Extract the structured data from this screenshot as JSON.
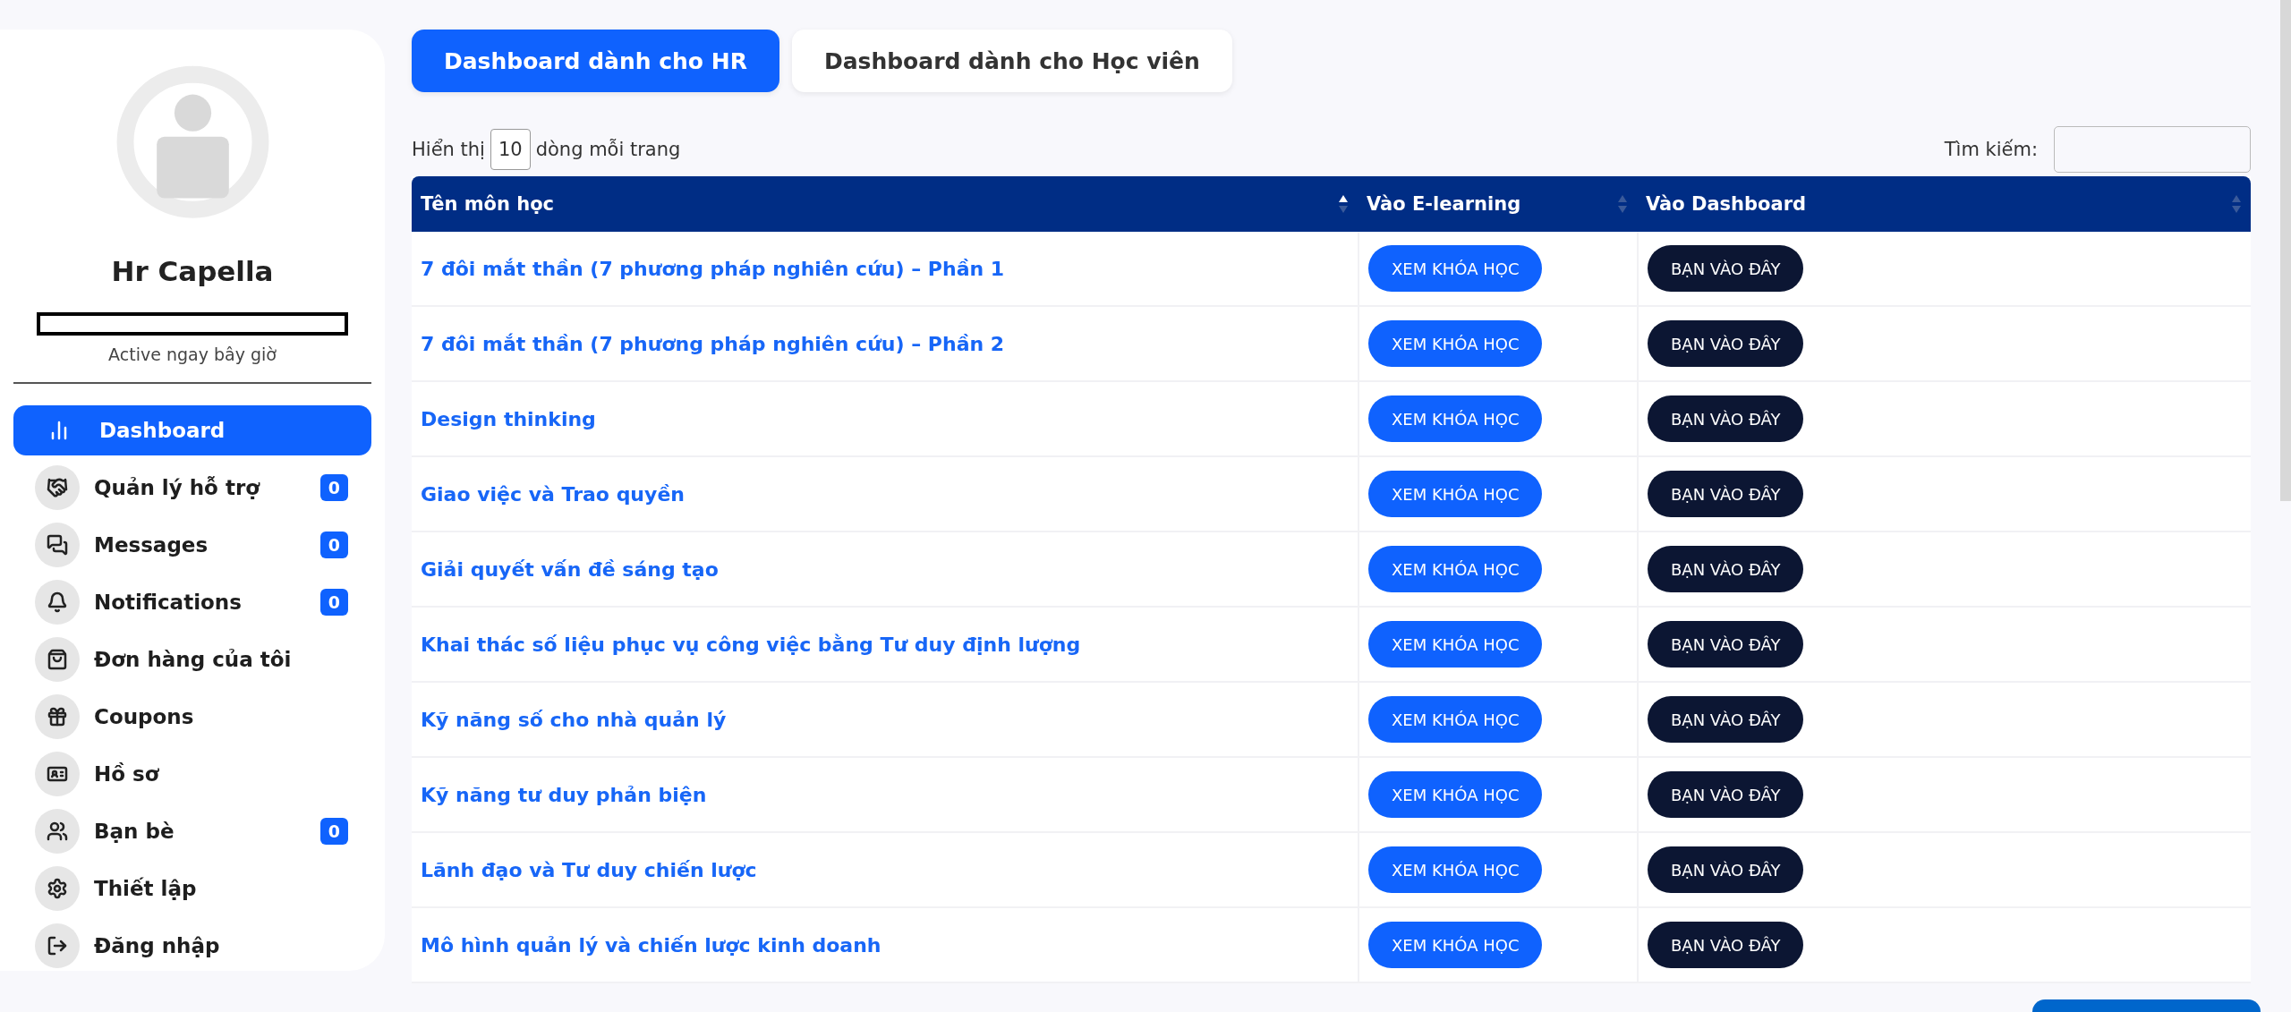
{
  "profile": {
    "name": "Hr Capella",
    "status": "Active ngay bây giờ"
  },
  "menu": [
    {
      "label": "Dashboard",
      "selected": true
    },
    {
      "label": "Quản lý hỗ trợ",
      "selected": false,
      "badge": "0"
    },
    {
      "label": "Messages",
      "selected": false,
      "badge": "0"
    },
    {
      "label": "Notifications",
      "selected": false,
      "badge": "0"
    },
    {
      "label": "Đơn hàng của tôi",
      "selected": false
    },
    {
      "label": "Coupons",
      "selected": false
    },
    {
      "label": "Hồ sơ",
      "selected": false
    },
    {
      "label": "Bạn bè",
      "selected": false,
      "badge": "0"
    },
    {
      "label": "Thiết lập",
      "selected": false
    },
    {
      "label": "Đăng nhập",
      "selected": false
    }
  ],
  "tabs": [
    {
      "label": "Dashboard dành cho HR",
      "selected": true
    },
    {
      "label": "Dashboard dành cho Học viên",
      "selected": false
    }
  ],
  "length_control": {
    "before": "Hiển thị",
    "value": "10",
    "after": "dòng mỗi trang"
  },
  "search": {
    "label": "Tìm kiếm:"
  },
  "table": {
    "columns": [
      {
        "label": "Tên môn học",
        "sorted": true
      },
      {
        "label": "Vào E-learning",
        "sorted": false
      },
      {
        "label": "Vào Dashboard",
        "sorted": false
      }
    ],
    "rows": [
      {
        "course": "7 đôi mắt thần (7 phương pháp nghiên cứu) – Phần 1",
        "elearning": "XEM KHÓA HỌC",
        "dashboard": "BẠN VÀO ĐÂY"
      },
      {
        "course": "7 đôi mắt thần (7 phương pháp nghiên cứu) – Phần 2",
        "elearning": "XEM KHÓA HỌC",
        "dashboard": "BẠN VÀO ĐÂY"
      },
      {
        "course": "Design thinking",
        "elearning": "XEM KHÓA HỌC",
        "dashboard": "BẠN VÀO ĐÂY"
      },
      {
        "course": "Giao việc và Trao quyền",
        "elearning": "XEM KHÓA HỌC",
        "dashboard": "BẠN VÀO ĐÂY"
      },
      {
        "course": "Giải quyết vấn đề sáng tạo",
        "elearning": "XEM KHÓA HỌC",
        "dashboard": "BẠN VÀO ĐÂY"
      },
      {
        "course": "Khai thác số liệu phục vụ công việc bằng Tư duy định lượng",
        "elearning": "XEM KHÓA HỌC",
        "dashboard": "BẠN VÀO ĐÂY"
      },
      {
        "course": "Kỹ năng số cho nhà quản lý",
        "elearning": "XEM KHÓA HỌC",
        "dashboard": "BẠN VÀO ĐÂY"
      },
      {
        "course": "Kỹ năng tư duy phản biện",
        "elearning": "XEM KHÓA HỌC",
        "dashboard": "BẠN VÀO ĐÂY"
      },
      {
        "course": "Lãnh đạo và Tư duy chiến lược",
        "elearning": "XEM KHÓA HỌC",
        "dashboard": "BẠN VÀO ĐÂY"
      },
      {
        "course": "Mô hình quản lý và chiến lược kinh doanh",
        "elearning": "XEM KHÓA HỌC",
        "dashboard": "BẠN VÀO ĐÂY"
      }
    ]
  }
}
